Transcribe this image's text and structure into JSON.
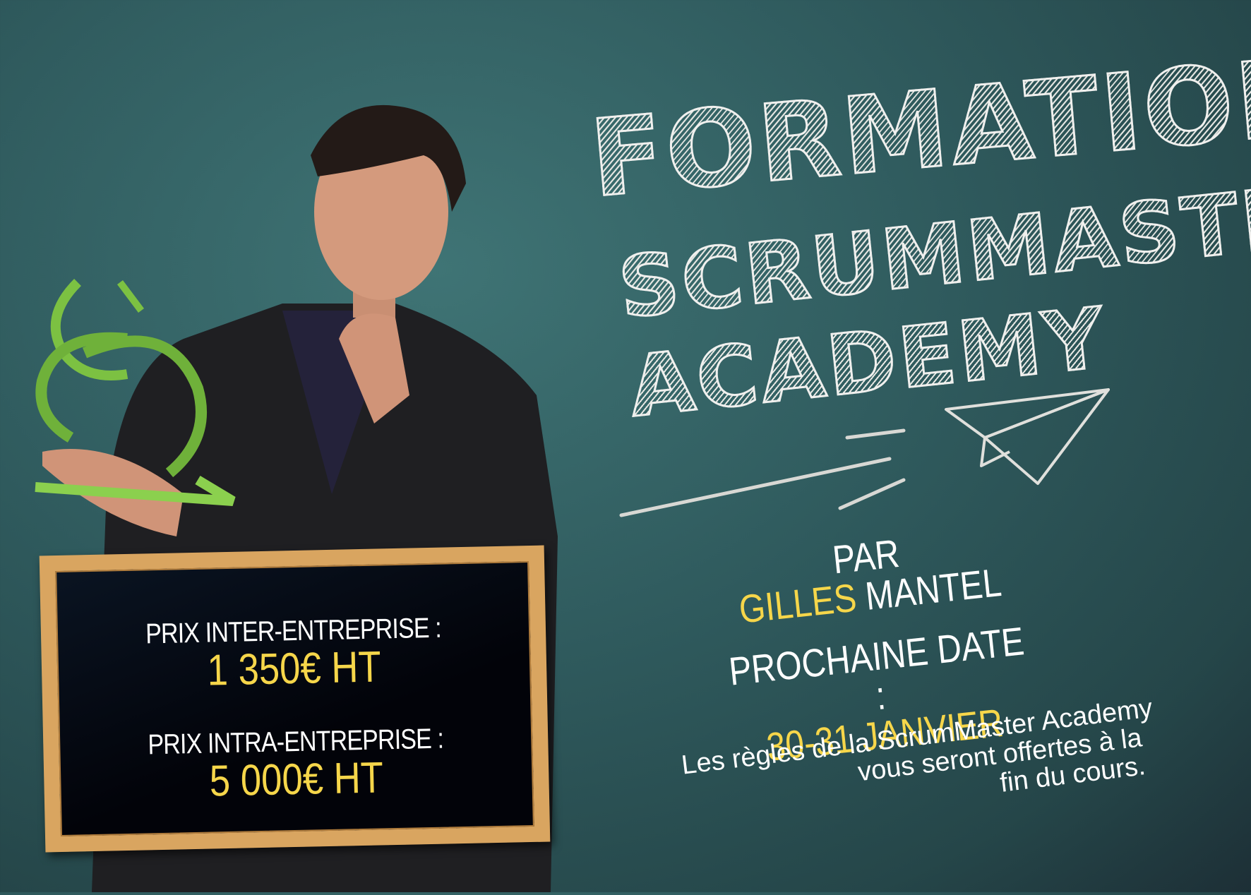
{
  "title": {
    "line1": "FORMATION",
    "line2": "SCRUMMASTER",
    "line3": "ACADEMY"
  },
  "board": {
    "inter_label": "PRIX INTER-ENTREPRISE :",
    "inter_price": "1 350€ HT",
    "intra_label": "PRIX INTRA-ENTREPRISE :",
    "intra_price": "5 000€ HT"
  },
  "trainer": {
    "par": "PAR",
    "first_name": "GILLES",
    "last_name": "MANTEL"
  },
  "next_date": {
    "label": "PROCHAINE DATE :",
    "value": "30-31 JANVIER"
  },
  "note": {
    "line1": "Les règles de la ScrumMaster Academy",
    "line2": "vous seront offertes à la",
    "line3": "fin du cours."
  },
  "colors": {
    "background": "#2f5a5d",
    "accent": "#f6d64a",
    "frame": "#d9a560",
    "logo": "#7cc142"
  },
  "icons": [
    "paper-plane-icon",
    "speed-lines-icon",
    "scrum-logo-icon"
  ]
}
